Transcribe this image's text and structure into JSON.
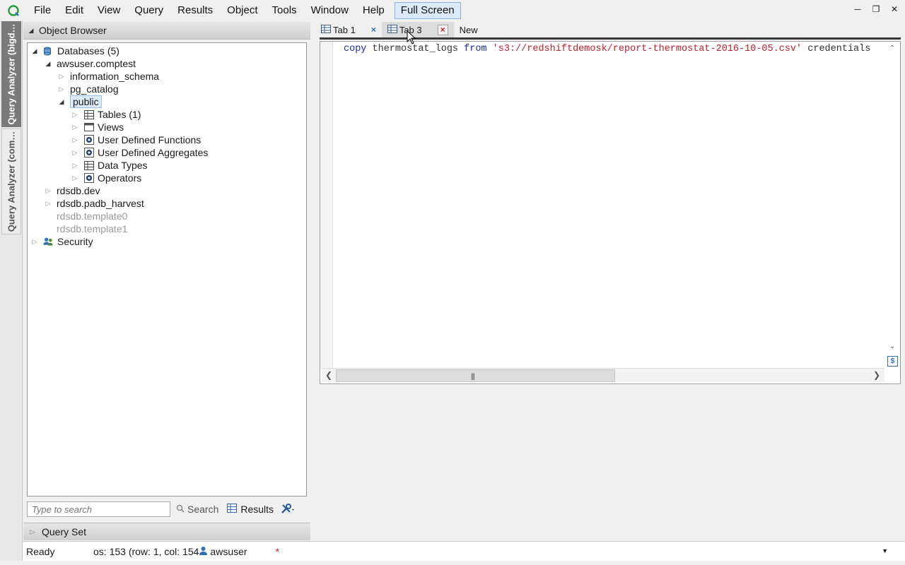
{
  "menubar": {
    "items": [
      "File",
      "Edit",
      "View",
      "Query",
      "Results",
      "Object",
      "Tools",
      "Window",
      "Help"
    ],
    "fullscreen_label": "Full Screen"
  },
  "vertical_tabs": {
    "tab1": "Query Analyzer (bigd…",
    "tab2": "Query Analyzer (com…"
  },
  "object_browser": {
    "title": "Object Browser",
    "tree": {
      "databases": "Databases (5)",
      "db_awsuser": "awsuser.comptest",
      "information_schema": "information_schema",
      "pg_catalog": "pg_catalog",
      "public": "public",
      "tables": "Tables (1)",
      "views": "Views",
      "udf": "User Defined Functions",
      "uda": "User Defined Aggregates",
      "data_types": "Data Types",
      "operators": "Operators",
      "rdsdb_dev": "rdsdb.dev",
      "rdsdb_padb": "rdsdb.padb_harvest",
      "template0": "rdsdb.template0",
      "template1": "rdsdb.template1",
      "security": "Security"
    },
    "search_placeholder": "Type to search",
    "search_label": "Search",
    "results_label": "Results"
  },
  "query_set": {
    "title": "Query Set"
  },
  "tabs": [
    {
      "label": "Tab 1"
    },
    {
      "label": "Tab 3"
    },
    {
      "label": "New"
    }
  ],
  "editor": {
    "tokens": {
      "kw1": "copy",
      "t1": " thermostat_logs ",
      "kw2": "from",
      "sp": " ",
      "str": "'s3://redshiftdemosk/report-thermostat-2016-10-05.csv'",
      "t2": " credentials"
    }
  },
  "status": {
    "ready": "Ready",
    "position": "os: 153 (row: 1, col: 154",
    "user": "awsuser",
    "modified": "*"
  },
  "colors": {
    "keyword": "#1b2aa8",
    "string": "#c0202a",
    "selection": "#dbe9f9"
  }
}
